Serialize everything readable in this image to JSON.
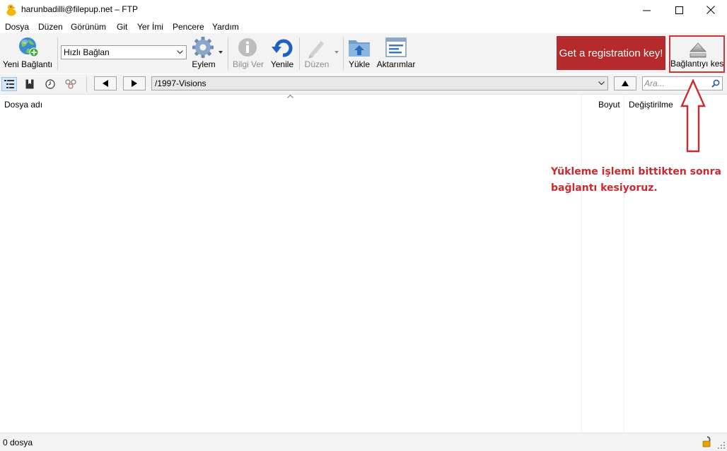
{
  "window": {
    "title": "harunbadilli@filepup.net – FTP",
    "app_icon": "duck-icon",
    "controls": [
      "minimize-icon",
      "maximize-icon",
      "close-icon"
    ]
  },
  "menu": [
    "Dosya",
    "Düzen",
    "Görünüm",
    "Git",
    "Yer İmi",
    "Pencere",
    "Yardım"
  ],
  "toolbar": {
    "new_connection": "Yeni Bağlantı",
    "quick_connect": "Hızlı Bağlan",
    "action": "Eylem",
    "info": "Bilgi Ver",
    "refresh": "Yenile",
    "edit": "Düzen",
    "upload": "Yükle",
    "transfers": "Aktarımlar",
    "registration": "Get a registration key!",
    "disconnect": "Bağlantıyı kes"
  },
  "pathbar": {
    "path": "/1997-Visions",
    "search_placeholder": "Ara...",
    "icons": [
      "outline-view-icon",
      "bookmarks-icon",
      "history-icon",
      "bonjour-icon"
    ]
  },
  "filelist": {
    "columns": [
      "Dosya adı",
      "Boyut",
      "Değiştirilme"
    ]
  },
  "status": {
    "text": "0 dosya",
    "icon": "lock-icon"
  },
  "annotation": {
    "text_line1": "Yükleme işlemi bittikten sonra",
    "text_line2": "bağlantı kesiyoruz.",
    "color": "#cc2a2f"
  },
  "colors": {
    "registration_bg": "#b72a2b",
    "highlight_border": "#d23434"
  }
}
